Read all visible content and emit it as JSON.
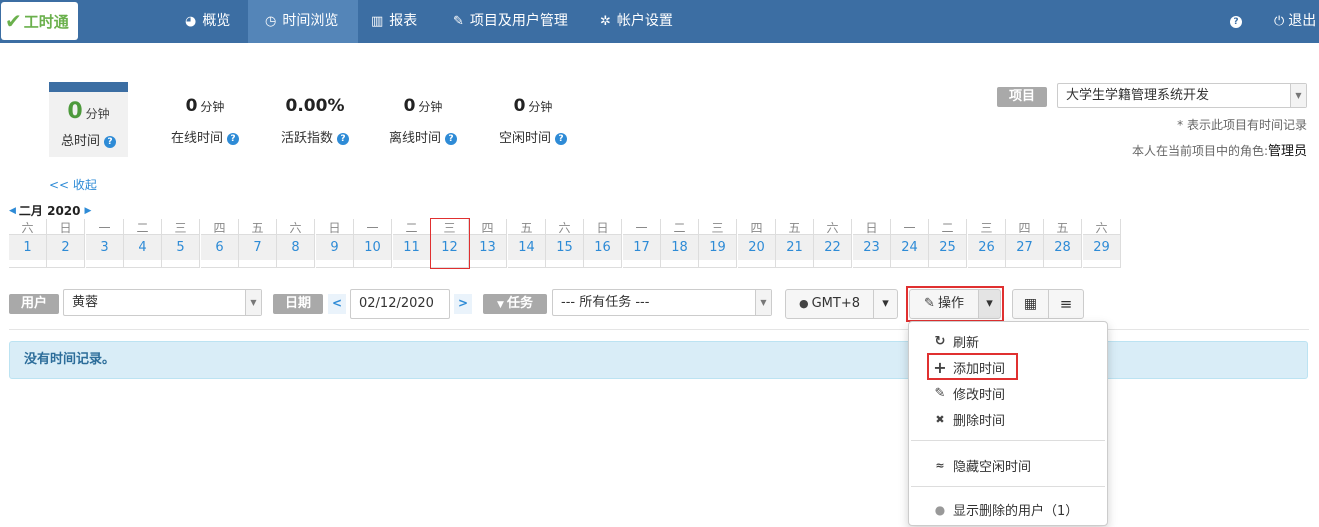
{
  "header": {
    "logo_text": "工时通",
    "nav": [
      {
        "icon": "dashboard-icon",
        "glyph": "◕",
        "label": "概览"
      },
      {
        "icon": "clock-icon",
        "glyph": "◷",
        "label": "时间浏览"
      },
      {
        "icon": "chart-icon",
        "glyph": "▥",
        "label": "报表"
      },
      {
        "icon": "wrench-icon",
        "glyph": "✎",
        "label": "项目及用户管理"
      },
      {
        "icon": "gear-icon",
        "glyph": "✲",
        "label": "帐户设置"
      }
    ],
    "help_glyph": "?",
    "logout_glyph": "⏻",
    "logout_label": "退出"
  },
  "stats": {
    "total": {
      "value": "0",
      "unit": "分钟",
      "label": "总时间"
    },
    "online": {
      "value": "0",
      "unit": "分钟",
      "label": "在线时间"
    },
    "activity": {
      "value": "0.00%",
      "label": "活跃指数"
    },
    "offline": {
      "value": "0",
      "unit": "分钟",
      "label": "离线时间"
    },
    "idle": {
      "value": "0",
      "unit": "分钟",
      "label": "空闲时间"
    },
    "help_glyph": "?"
  },
  "project": {
    "label": "项目",
    "value": "大学生学籍管理系统开发",
    "note": "* 表示此项目有时间记录",
    "role_prefix": "本人在当前项目中的角色:",
    "role": "管理员"
  },
  "collapse_label": "<< 收起",
  "calendar": {
    "month_label": "二月 2020",
    "prev_glyph": "◀",
    "next_glyph": "▶",
    "days": [
      {
        "wd": "六",
        "d": "1"
      },
      {
        "wd": "日",
        "d": "2"
      },
      {
        "wd": "一",
        "d": "3"
      },
      {
        "wd": "二",
        "d": "4"
      },
      {
        "wd": "三",
        "d": "5"
      },
      {
        "wd": "四",
        "d": "6"
      },
      {
        "wd": "五",
        "d": "7"
      },
      {
        "wd": "六",
        "d": "8"
      },
      {
        "wd": "日",
        "d": "9"
      },
      {
        "wd": "一",
        "d": "10"
      },
      {
        "wd": "二",
        "d": "11"
      },
      {
        "wd": "三",
        "d": "12"
      },
      {
        "wd": "四",
        "d": "13"
      },
      {
        "wd": "五",
        "d": "14"
      },
      {
        "wd": "六",
        "d": "15"
      },
      {
        "wd": "日",
        "d": "16"
      },
      {
        "wd": "一",
        "d": "17"
      },
      {
        "wd": "二",
        "d": "18"
      },
      {
        "wd": "三",
        "d": "19"
      },
      {
        "wd": "四",
        "d": "20"
      },
      {
        "wd": "五",
        "d": "21"
      },
      {
        "wd": "六",
        "d": "22"
      },
      {
        "wd": "日",
        "d": "23"
      },
      {
        "wd": "一",
        "d": "24"
      },
      {
        "wd": "二",
        "d": "25"
      },
      {
        "wd": "三",
        "d": "26"
      },
      {
        "wd": "四",
        "d": "27"
      },
      {
        "wd": "五",
        "d": "28"
      },
      {
        "wd": "六",
        "d": "29"
      }
    ],
    "selected": "12"
  },
  "filters": {
    "user_label": "用户",
    "user_value": "黄蓉",
    "date_label": "日期",
    "date_value": "02/12/2020",
    "date_prev": "<",
    "date_next": ">",
    "task_label": "任务",
    "task_glyph": "▼",
    "task_value": "--- 所有任务 ---",
    "timezone": "GMT+8",
    "globe_glyph": "●",
    "caret_glyph": "▾",
    "action_label": "操作",
    "action_glyph": "✎",
    "grid_glyph": "▦",
    "list_glyph": "≡"
  },
  "notice": "没有时间记录。",
  "menu": {
    "items": [
      {
        "glyph": "↻",
        "label": "刷新"
      },
      {
        "glyph": "+",
        "label": "添加时间"
      },
      {
        "glyph": "✎",
        "label": "修改时间"
      },
      {
        "glyph": "✖",
        "label": "删除时间"
      }
    ],
    "hide_idle": {
      "glyph": "≈",
      "label": "隐藏空闲时间"
    },
    "show_deleted": {
      "glyph": "●",
      "label": "显示删除的用户（1）"
    }
  },
  "colors": {
    "nav_bg": "#3c6ea3",
    "link": "#2e8bd6",
    "highlight_border": "#e03030",
    "notice_bg": "#d9edf7"
  }
}
